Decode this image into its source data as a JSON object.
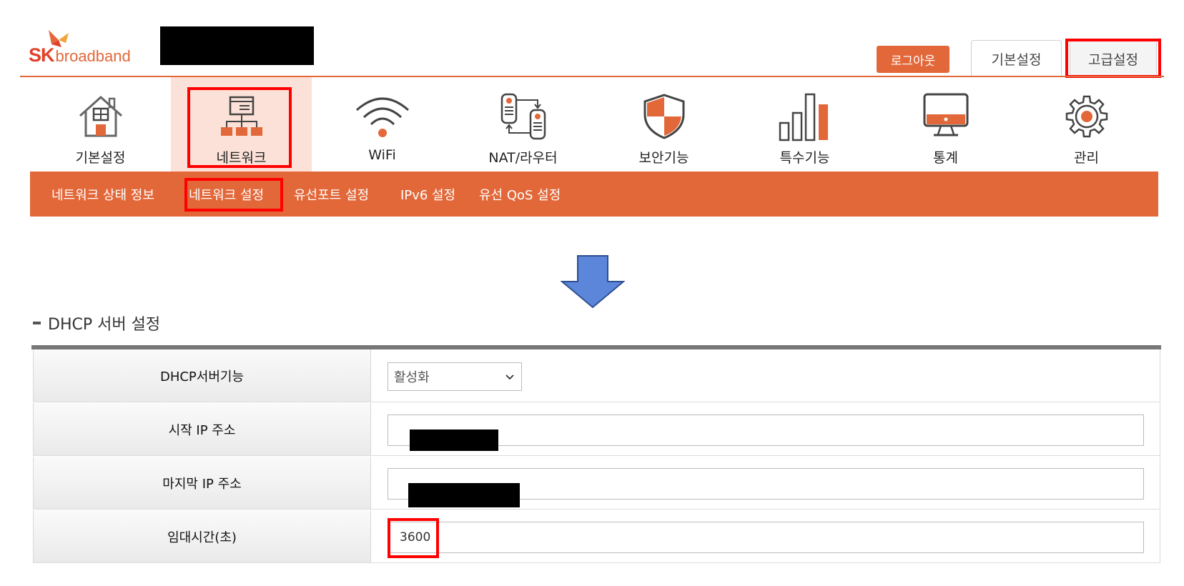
{
  "brand": {
    "sk": "SK",
    "broadband": "broadband"
  },
  "header": {
    "logout_label": "로그아웃",
    "tab_basic": "기본설정",
    "tab_advanced": "고급설정"
  },
  "menu": {
    "items": [
      {
        "label": "기본설정",
        "icon": "house-icon"
      },
      {
        "label": "네트워크",
        "icon": "network-icon",
        "active": true
      },
      {
        "label": "WiFi",
        "icon": "wifi-icon"
      },
      {
        "label": "NAT/라우터",
        "icon": "router-icon"
      },
      {
        "label": "보안기능",
        "icon": "shield-icon"
      },
      {
        "label": "특수기능",
        "icon": "bar-chart-icon"
      },
      {
        "label": "통계",
        "icon": "monitor-icon"
      },
      {
        "label": "관리",
        "icon": "gear-icon"
      }
    ]
  },
  "submenu": {
    "items": [
      {
        "label": "네트워크 상태 정보"
      },
      {
        "label": "네트워크 설정",
        "active": true
      },
      {
        "label": "유선포트 설정"
      },
      {
        "label": "IPv6 설정"
      },
      {
        "label": "유선 QoS 설정"
      }
    ]
  },
  "section": {
    "title": "DHCP 서버 설정",
    "rows": [
      {
        "label": "DHCP서버기능",
        "type": "select",
        "value": "활성화"
      },
      {
        "label": "시작 IP 주소",
        "type": "input",
        "value": ""
      },
      {
        "label": "마지막 IP 주소",
        "type": "input",
        "value": ""
      },
      {
        "label": "임대시간(초)",
        "type": "input",
        "value": "3600"
      }
    ]
  },
  "colors": {
    "accent": "#e2683a",
    "highlight": "#ff0000",
    "arrow": "#5b86d9",
    "active_menu_bg": "#fbe1d7"
  }
}
